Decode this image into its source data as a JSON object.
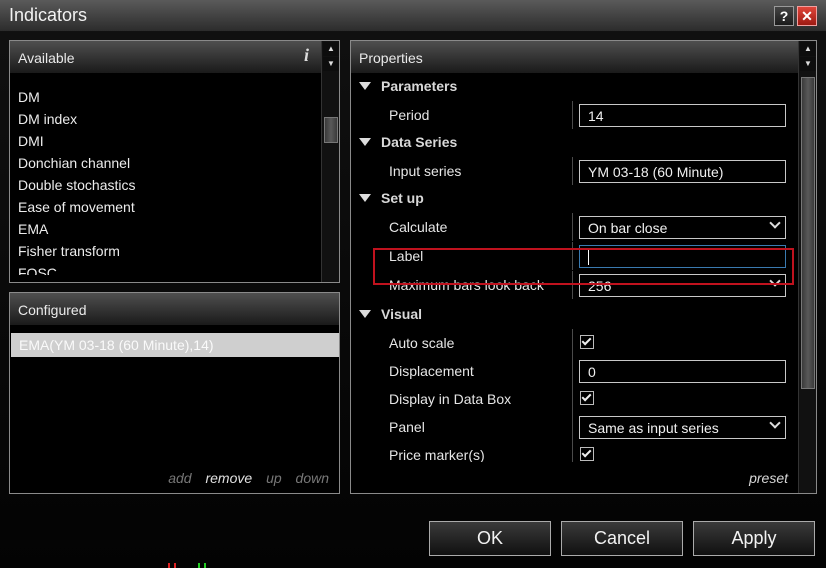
{
  "window": {
    "title": "Indicators",
    "help_label": "?",
    "close_label": "✕"
  },
  "available": {
    "header": "Available",
    "info_label": "i",
    "items": [
      "DM",
      "DM index",
      "DMI",
      "Donchian channel",
      "Double stochastics",
      "Ease of movement",
      "EMA",
      "Fisher transform",
      "FOSC"
    ]
  },
  "configured": {
    "header": "Configured",
    "items": [
      "EMA(YM 03-18 (60 Minute),14)"
    ],
    "actions": {
      "add": "add",
      "remove": "remove",
      "up": "up",
      "down": "down"
    }
  },
  "properties": {
    "header": "Properties",
    "parameters": {
      "label": "Parameters",
      "period_label": "Period",
      "period_value": "14"
    },
    "data_series": {
      "label": "Data Series",
      "input_series_label": "Input series",
      "input_series_value": "YM 03-18 (60 Minute)"
    },
    "setup": {
      "label": "Set up",
      "calculate_label": "Calculate",
      "calculate_value": "On bar close",
      "label_label": "Label",
      "label_value": "",
      "max_bars_label": "Maximum bars look back",
      "max_bars_value": "256"
    },
    "visual": {
      "label": "Visual",
      "auto_scale_label": "Auto scale",
      "auto_scale_checked": true,
      "displacement_label": "Displacement",
      "displacement_value": "0",
      "display_in_data_box_label": "Display in Data Box",
      "display_in_data_box_checked": true,
      "panel_label": "Panel",
      "panel_value": "Same as input series",
      "price_marker_label": "Price marker(s)"
    },
    "preset_label": "preset"
  },
  "buttons": {
    "ok": "OK",
    "cancel": "Cancel",
    "apply": "Apply"
  },
  "colors": {
    "highlight": "#c0121e",
    "focus": "#3a7ab0",
    "selected_row": "#cfcfcf"
  }
}
